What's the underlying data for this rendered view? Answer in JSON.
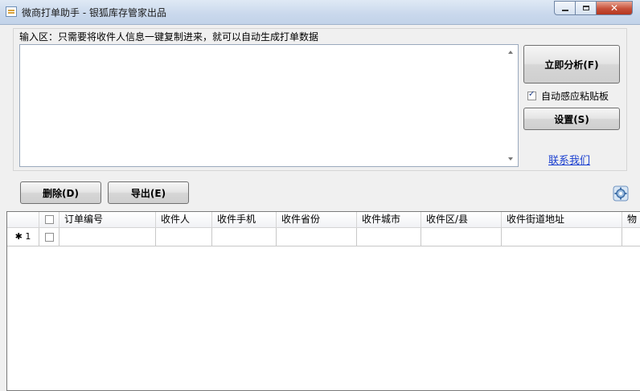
{
  "window": {
    "title": "微商打单助手 - 银狐库存管家出品"
  },
  "input": {
    "label": "输入区：只需要将收件人信息一键复制进来，就可以自动生成打单数据",
    "value": ""
  },
  "side": {
    "analyze_label": "立即分析(F)",
    "auto_paste_label": "自动感应粘贴板",
    "auto_paste_checked": true,
    "settings_label": "设置(S)",
    "contact_label": "联系我们"
  },
  "toolbar": {
    "delete_label": "删除(D)",
    "export_label": "导出(E)"
  },
  "grid": {
    "columns": [
      "订单编号",
      "收件人",
      "收件手机",
      "收件省份",
      "收件城市",
      "收件区/县",
      "收件街道地址",
      "物"
    ],
    "rows": [
      {
        "marker": "✱",
        "number": "1",
        "cells": [
          "",
          "",
          "",
          "",
          "",
          "",
          ""
        ]
      }
    ]
  },
  "colors": {
    "link": "#1a3fd0",
    "title_bar": "#c9d8ec",
    "close_button": "#c7513a"
  }
}
